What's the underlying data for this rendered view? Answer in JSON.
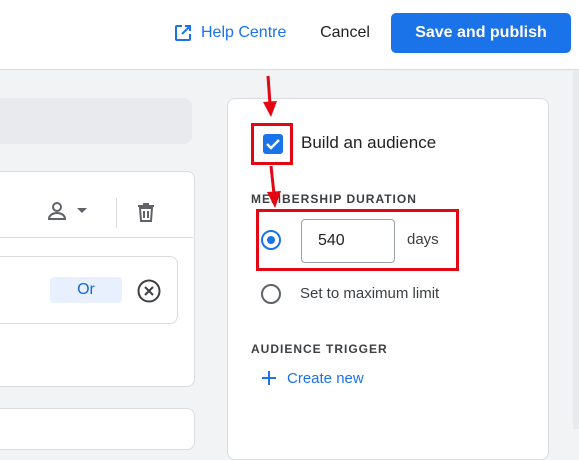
{
  "header": {
    "help_label": "Help Centre",
    "cancel_label": "Cancel",
    "publish_label": "Save and publish"
  },
  "builder": {
    "or_label": "Or"
  },
  "audience_panel": {
    "build_label": "Build an audience",
    "build_checked": true,
    "membership_heading": "MEMBERSHIP DURATION",
    "duration_value": "540",
    "duration_unit": "days",
    "max_limit_label": "Set to maximum limit",
    "selected_option": "days",
    "trigger_heading": "AUDIENCE TRIGGER",
    "create_label": "Create new"
  },
  "colors": {
    "accent": "#1a73e8",
    "annotation": "#e30613"
  },
  "icons": [
    "open-in-new-icon",
    "person-icon",
    "dropdown-arrow-icon",
    "trash-icon",
    "remove-circle-icon",
    "check-icon",
    "plus-icon"
  ]
}
